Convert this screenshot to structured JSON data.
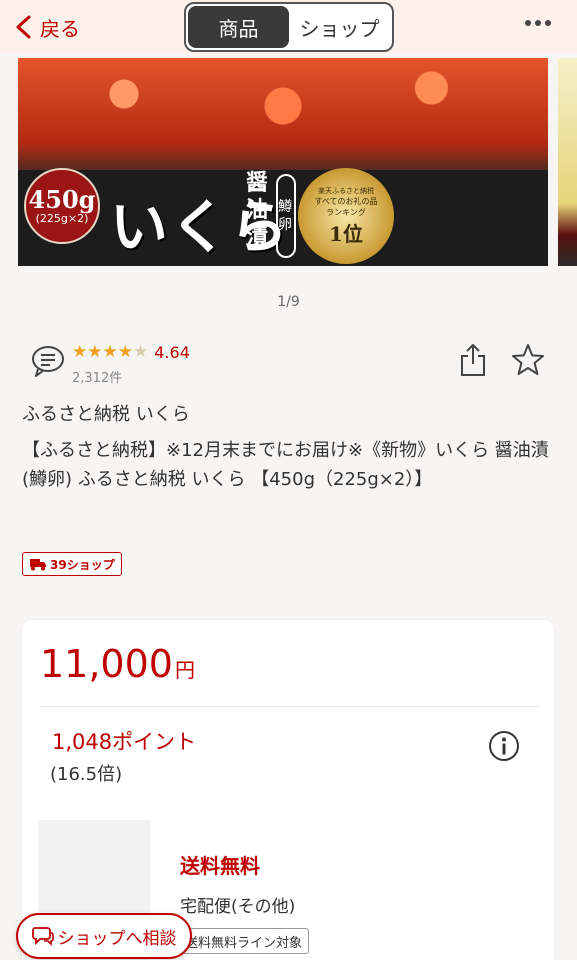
{
  "header": {
    "back_label": "戻る",
    "tabs": [
      {
        "label": "商品",
        "active": true
      },
      {
        "label": "ショップ",
        "active": false
      }
    ],
    "more_icon": "more-dots-icon"
  },
  "hero": {
    "weight": "450g",
    "weight_detail": "(225g×2)",
    "title": "いくら",
    "subtitle": "醤油漬",
    "variety": "鱒卵",
    "medal_line1": "楽天ふるさと納税",
    "medal_line2": "すべてのお礼の品",
    "medal_line3": "ランキング",
    "medal_rank": "1位"
  },
  "pager": "1/9",
  "rating": {
    "value": "4.64",
    "stars": 4.64,
    "review_count": "2,312件"
  },
  "product": {
    "shop_name": "ふるさと納税 いくら",
    "title": "【ふるさと納税】※12月末までにお届け※《新物》いくら 醤油漬 (鱒卵) ふるさと納税 いくら 【450g（225g×2）】",
    "shipping_badge": "39ショップ"
  },
  "price_card": {
    "price": "11,000",
    "currency": "円",
    "points": "1,048ポイント",
    "multiplier": "(16.5倍)",
    "shipping": "送料無料",
    "carrier": "宅配便(その他)",
    "line_tag": "送料無料ライン対象"
  },
  "consult_button": "ショップへ相談",
  "colors": {
    "accent": "#bf0000",
    "star": "#f0a01e",
    "header_bg": "#fbf0ea"
  }
}
